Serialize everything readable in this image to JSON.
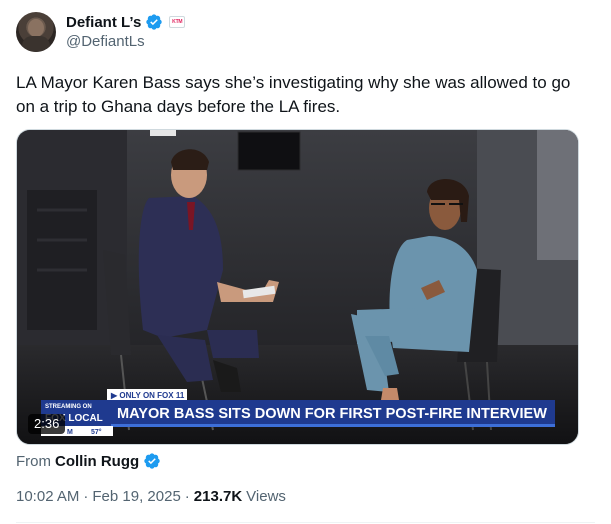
{
  "author": {
    "display_name": "Defiant L’s",
    "handle": "@DefiantLs",
    "verified_icon": "verified-badge-icon",
    "affiliation_icon": "affiliate-label-icon",
    "affiliation_text": "KTM"
  },
  "tweet": {
    "text": "LA Mayor Karen Bass says she’s investigating why she was allowed to go on a trip to Ghana days before the LA fires."
  },
  "media": {
    "duration": "2:36",
    "overlay": {
      "streaming_label": "STREAMING ON",
      "network_label": "FOX LOCAL",
      "only_on_label": "▶ ONLY ON FOX 11",
      "headline": "MAYOR BASS SITS DOWN FOR FIRST POST-FIRE INTERVIEW",
      "time_label": "M",
      "temp_label": "57°"
    }
  },
  "source": {
    "label": "From",
    "name": "Collin Rugg"
  },
  "meta": {
    "time": "10:02 AM",
    "separator1": "·",
    "date": "Feb 19, 2025",
    "separator2": "·",
    "views_count": "213.7K",
    "views_label": "Views"
  },
  "colors": {
    "verified_blue": "#1d9bf0",
    "secondary_text": "#536471",
    "lower_third_blue": "#1f3a8f"
  }
}
